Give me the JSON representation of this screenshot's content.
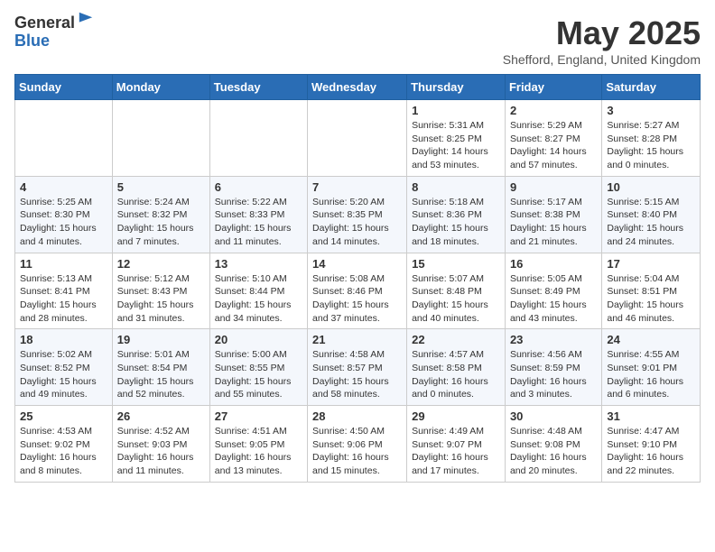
{
  "header": {
    "logo_general": "General",
    "logo_blue": "Blue",
    "month": "May 2025",
    "location": "Shefford, England, United Kingdom"
  },
  "weekdays": [
    "Sunday",
    "Monday",
    "Tuesday",
    "Wednesday",
    "Thursday",
    "Friday",
    "Saturday"
  ],
  "weeks": [
    [
      {
        "day": "",
        "info": ""
      },
      {
        "day": "",
        "info": ""
      },
      {
        "day": "",
        "info": ""
      },
      {
        "day": "",
        "info": ""
      },
      {
        "day": "1",
        "info": "Sunrise: 5:31 AM\nSunset: 8:25 PM\nDaylight: 14 hours\nand 53 minutes."
      },
      {
        "day": "2",
        "info": "Sunrise: 5:29 AM\nSunset: 8:27 PM\nDaylight: 14 hours\nand 57 minutes."
      },
      {
        "day": "3",
        "info": "Sunrise: 5:27 AM\nSunset: 8:28 PM\nDaylight: 15 hours\nand 0 minutes."
      }
    ],
    [
      {
        "day": "4",
        "info": "Sunrise: 5:25 AM\nSunset: 8:30 PM\nDaylight: 15 hours\nand 4 minutes."
      },
      {
        "day": "5",
        "info": "Sunrise: 5:24 AM\nSunset: 8:32 PM\nDaylight: 15 hours\nand 7 minutes."
      },
      {
        "day": "6",
        "info": "Sunrise: 5:22 AM\nSunset: 8:33 PM\nDaylight: 15 hours\nand 11 minutes."
      },
      {
        "day": "7",
        "info": "Sunrise: 5:20 AM\nSunset: 8:35 PM\nDaylight: 15 hours\nand 14 minutes."
      },
      {
        "day": "8",
        "info": "Sunrise: 5:18 AM\nSunset: 8:36 PM\nDaylight: 15 hours\nand 18 minutes."
      },
      {
        "day": "9",
        "info": "Sunrise: 5:17 AM\nSunset: 8:38 PM\nDaylight: 15 hours\nand 21 minutes."
      },
      {
        "day": "10",
        "info": "Sunrise: 5:15 AM\nSunset: 8:40 PM\nDaylight: 15 hours\nand 24 minutes."
      }
    ],
    [
      {
        "day": "11",
        "info": "Sunrise: 5:13 AM\nSunset: 8:41 PM\nDaylight: 15 hours\nand 28 minutes."
      },
      {
        "day": "12",
        "info": "Sunrise: 5:12 AM\nSunset: 8:43 PM\nDaylight: 15 hours\nand 31 minutes."
      },
      {
        "day": "13",
        "info": "Sunrise: 5:10 AM\nSunset: 8:44 PM\nDaylight: 15 hours\nand 34 minutes."
      },
      {
        "day": "14",
        "info": "Sunrise: 5:08 AM\nSunset: 8:46 PM\nDaylight: 15 hours\nand 37 minutes."
      },
      {
        "day": "15",
        "info": "Sunrise: 5:07 AM\nSunset: 8:48 PM\nDaylight: 15 hours\nand 40 minutes."
      },
      {
        "day": "16",
        "info": "Sunrise: 5:05 AM\nSunset: 8:49 PM\nDaylight: 15 hours\nand 43 minutes."
      },
      {
        "day": "17",
        "info": "Sunrise: 5:04 AM\nSunset: 8:51 PM\nDaylight: 15 hours\nand 46 minutes."
      }
    ],
    [
      {
        "day": "18",
        "info": "Sunrise: 5:02 AM\nSunset: 8:52 PM\nDaylight: 15 hours\nand 49 minutes."
      },
      {
        "day": "19",
        "info": "Sunrise: 5:01 AM\nSunset: 8:54 PM\nDaylight: 15 hours\nand 52 minutes."
      },
      {
        "day": "20",
        "info": "Sunrise: 5:00 AM\nSunset: 8:55 PM\nDaylight: 15 hours\nand 55 minutes."
      },
      {
        "day": "21",
        "info": "Sunrise: 4:58 AM\nSunset: 8:57 PM\nDaylight: 15 hours\nand 58 minutes."
      },
      {
        "day": "22",
        "info": "Sunrise: 4:57 AM\nSunset: 8:58 PM\nDaylight: 16 hours\nand 0 minutes."
      },
      {
        "day": "23",
        "info": "Sunrise: 4:56 AM\nSunset: 8:59 PM\nDaylight: 16 hours\nand 3 minutes."
      },
      {
        "day": "24",
        "info": "Sunrise: 4:55 AM\nSunset: 9:01 PM\nDaylight: 16 hours\nand 6 minutes."
      }
    ],
    [
      {
        "day": "25",
        "info": "Sunrise: 4:53 AM\nSunset: 9:02 PM\nDaylight: 16 hours\nand 8 minutes."
      },
      {
        "day": "26",
        "info": "Sunrise: 4:52 AM\nSunset: 9:03 PM\nDaylight: 16 hours\nand 11 minutes."
      },
      {
        "day": "27",
        "info": "Sunrise: 4:51 AM\nSunset: 9:05 PM\nDaylight: 16 hours\nand 13 minutes."
      },
      {
        "day": "28",
        "info": "Sunrise: 4:50 AM\nSunset: 9:06 PM\nDaylight: 16 hours\nand 15 minutes."
      },
      {
        "day": "29",
        "info": "Sunrise: 4:49 AM\nSunset: 9:07 PM\nDaylight: 16 hours\nand 17 minutes."
      },
      {
        "day": "30",
        "info": "Sunrise: 4:48 AM\nSunset: 9:08 PM\nDaylight: 16 hours\nand 20 minutes."
      },
      {
        "day": "31",
        "info": "Sunrise: 4:47 AM\nSunset: 9:10 PM\nDaylight: 16 hours\nand 22 minutes."
      }
    ]
  ]
}
